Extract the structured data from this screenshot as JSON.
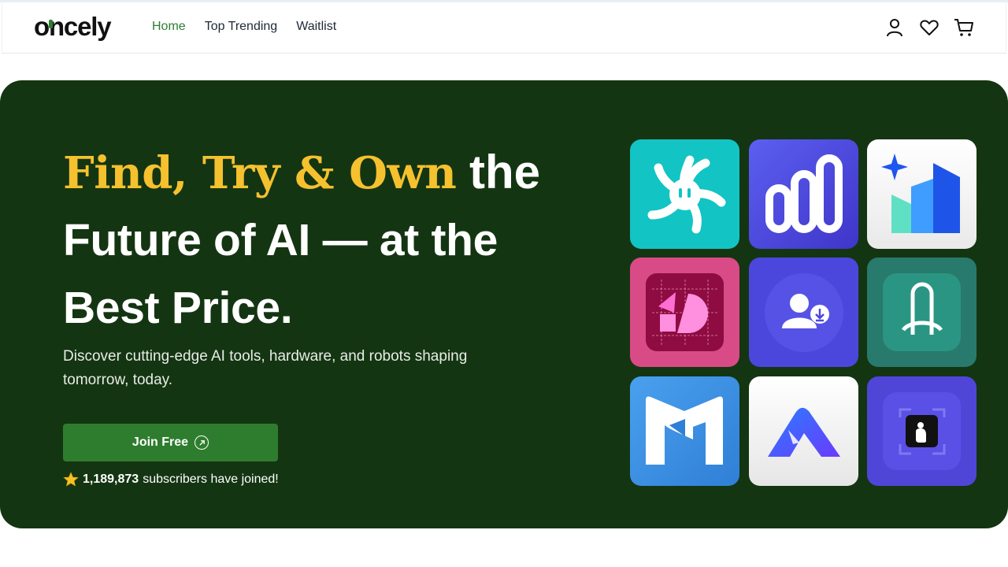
{
  "header": {
    "logo_text": "oncely",
    "nav": [
      {
        "label": "Home",
        "active": true
      },
      {
        "label": "Top Trending",
        "active": false
      },
      {
        "label": "Waitlist",
        "active": false
      }
    ],
    "icons": [
      "user-icon",
      "heart-icon",
      "cart-icon"
    ]
  },
  "hero": {
    "headline_accent": "Find, Try & Own",
    "headline_line1_rest": " the",
    "headline_line2": "Future of AI — at the",
    "headline_line3": "Best Price.",
    "subtitle": "Discover cutting-edge AI tools, hardware, and robots shaping tomorrow, today.",
    "cta_label": "Join Free",
    "subscribers_count": "1,189,873",
    "subscribers_text": " subscribers have joined!"
  },
  "tiles": [
    {
      "name": "swirl-app-icon",
      "bg": "#12c4c4"
    },
    {
      "name": "bar-chart-app-icon",
      "bg": "#4f46e5"
    },
    {
      "name": "sparkle-chart-app-icon",
      "bg": "#f3f3f3"
    },
    {
      "name": "shapes-app-icon",
      "bg": "#d94b86"
    },
    {
      "name": "user-download-app-icon",
      "bg": "#4c47dc"
    },
    {
      "name": "arch-app-icon",
      "bg": "#2a8a78"
    },
    {
      "name": "m-logo-app-icon",
      "bg": "#3a8ee0"
    },
    {
      "name": "a-logo-app-icon",
      "bg": "#f0f0f0"
    },
    {
      "name": "frame-app-icon",
      "bg": "#4f46d8"
    }
  ],
  "colors": {
    "hero_bg": "#143512",
    "accent_yellow": "#f5c12e",
    "brand_green": "#2e7d32"
  }
}
